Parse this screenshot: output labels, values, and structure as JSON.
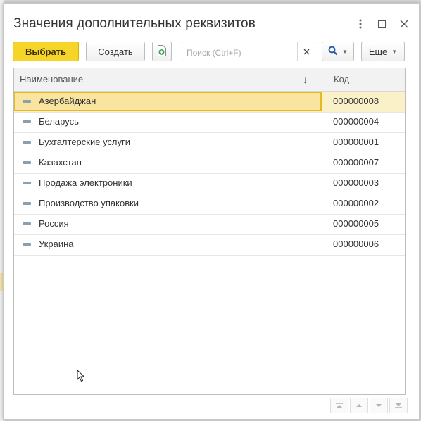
{
  "window": {
    "title": "Значения дополнительных реквизитов"
  },
  "toolbar": {
    "select_label": "Выбрать",
    "create_label": "Создать",
    "search_placeholder": "Поиск (Ctrl+F)",
    "search_value": "",
    "more_label": "Еще"
  },
  "table": {
    "columns": [
      "Наименование",
      "Код"
    ],
    "rows": [
      {
        "name": "Азербайджан",
        "code": "000000008",
        "selected": true
      },
      {
        "name": "Беларусь",
        "code": "000000004"
      },
      {
        "name": "Бухгалтерские услуги",
        "code": "000000001"
      },
      {
        "name": "Казахстан",
        "code": "000000007"
      },
      {
        "name": "Продажа электроники",
        "code": "000000003"
      },
      {
        "name": "Производство упаковки",
        "code": "000000002"
      },
      {
        "name": "Россия",
        "code": "000000005"
      },
      {
        "name": "Украина",
        "code": "000000006"
      }
    ]
  },
  "colors": {
    "accent_button": "#f5d52a",
    "selection_fill": "#f9e4a0",
    "selection_border": "#e8b820"
  }
}
